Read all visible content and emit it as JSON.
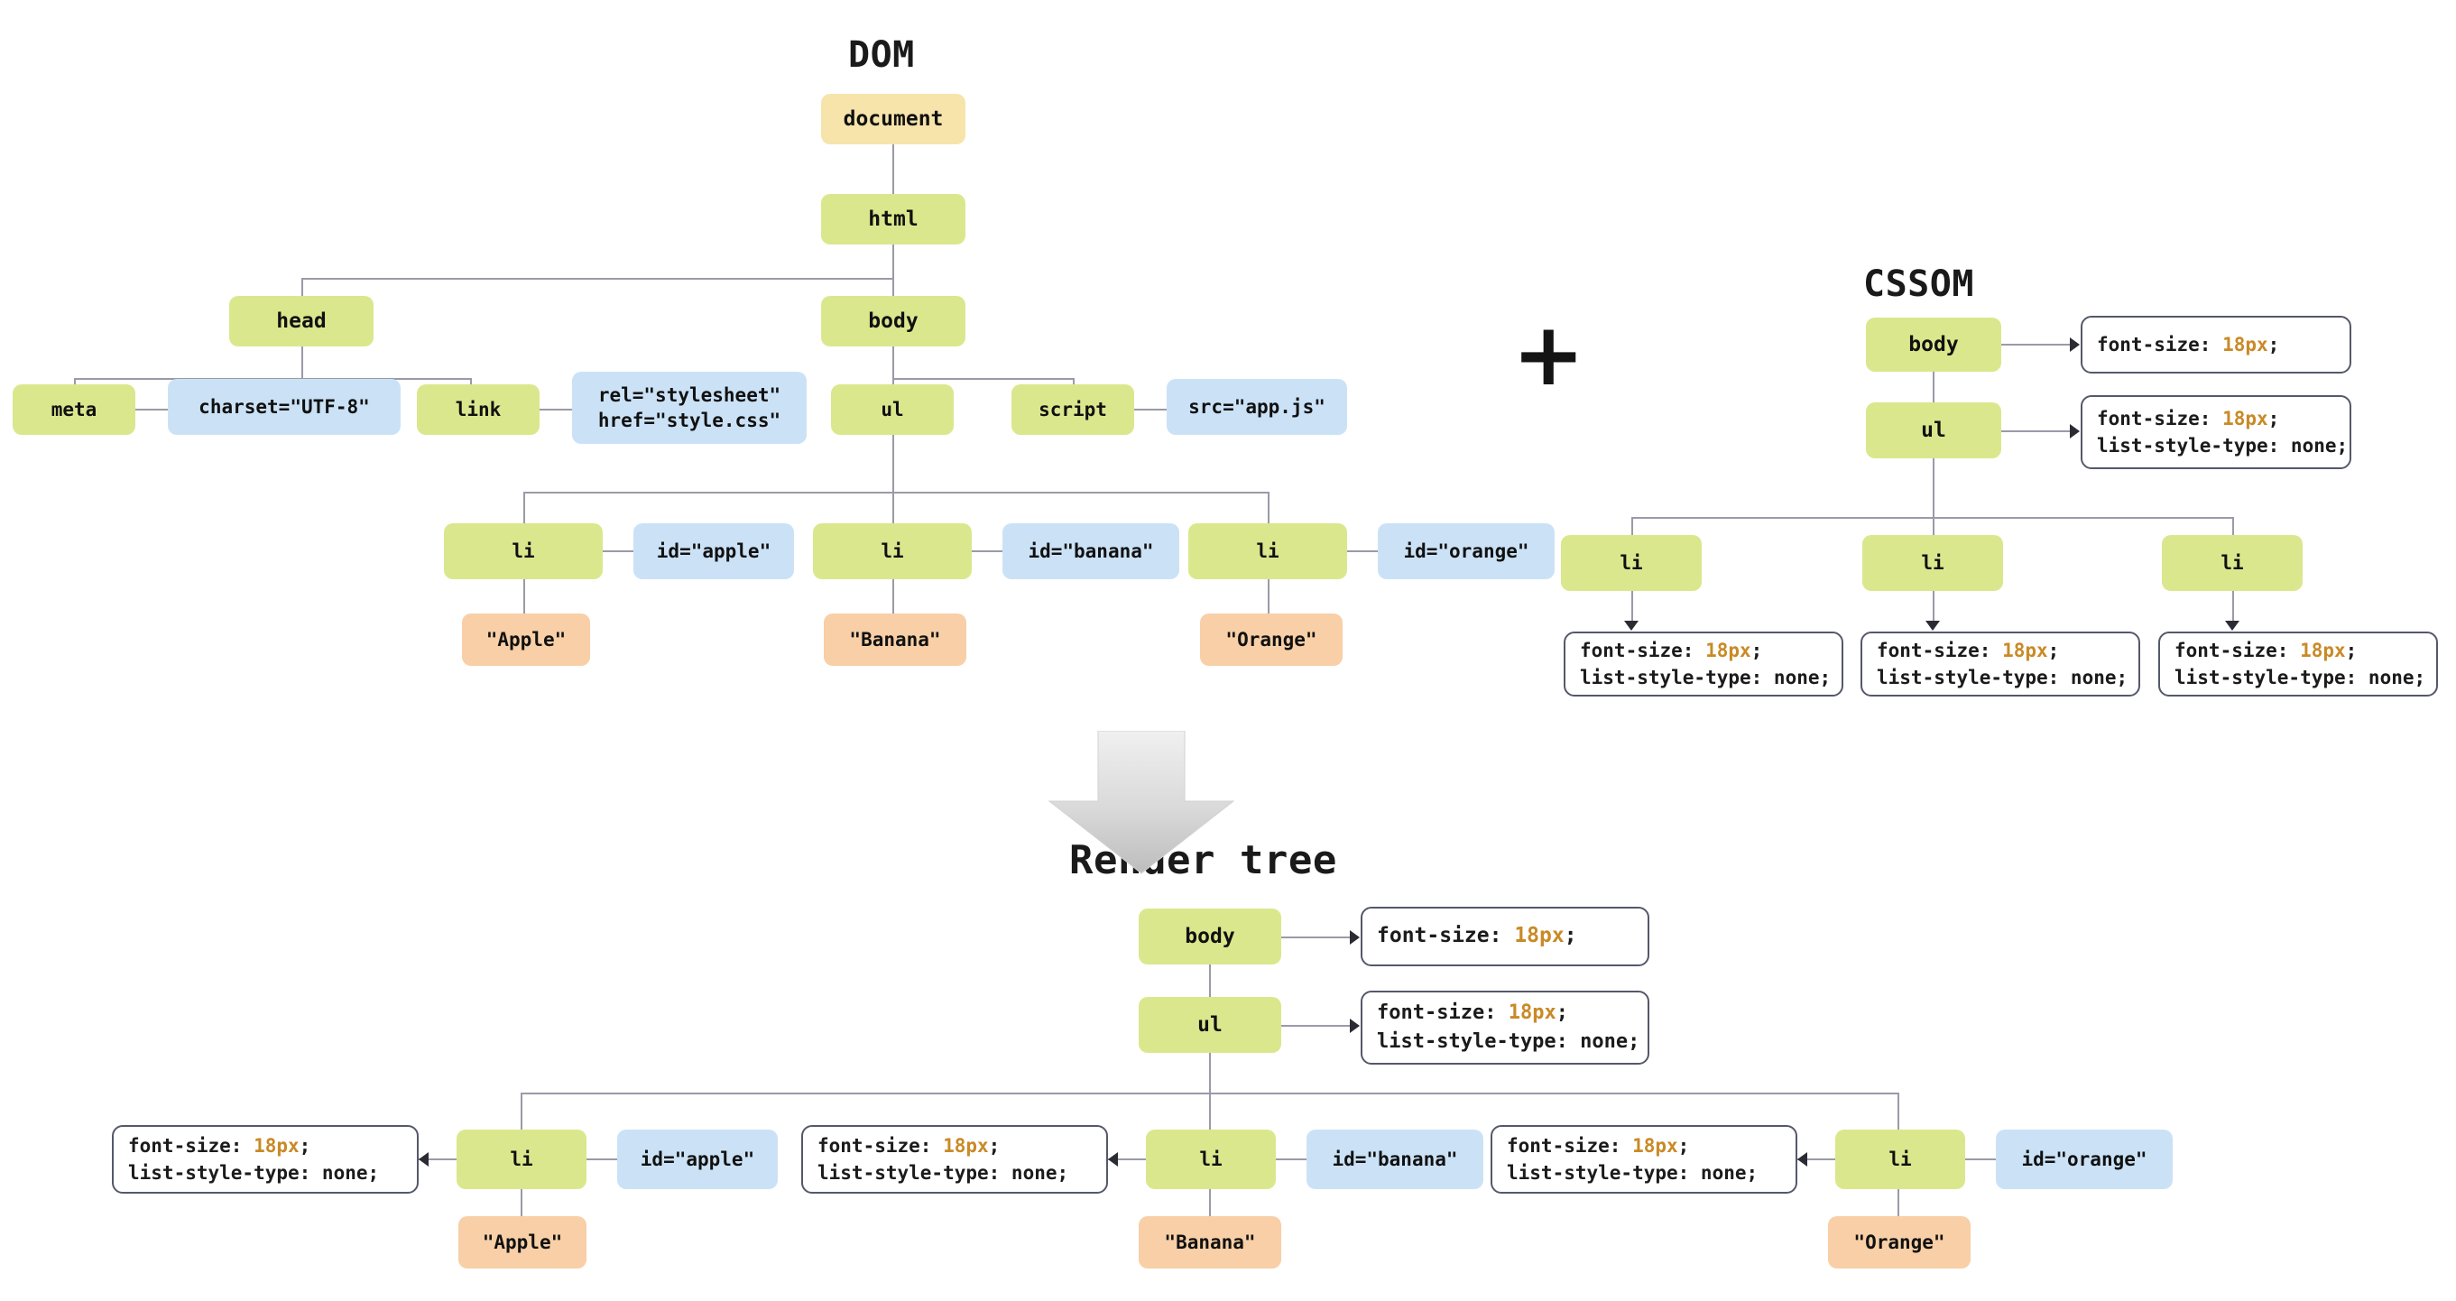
{
  "titles": {
    "dom": "DOM",
    "cssom": "CSSOM",
    "render_tree": "Render tree",
    "plus": "+"
  },
  "dom": {
    "document": "document",
    "html": "html",
    "head": "head",
    "body": "body",
    "meta": "meta",
    "meta_attr": "charset=\"UTF-8\"",
    "link": "link",
    "link_attr": "rel=\"stylesheet\"\nhref=\"style.css\"",
    "ul": "ul",
    "script": "script",
    "script_attr": "src=\"app.js\"",
    "items": [
      {
        "tag": "li",
        "attr": "id=\"apple\"",
        "text": "\"Apple\""
      },
      {
        "tag": "li",
        "attr": "id=\"banana\"",
        "text": "\"Banana\""
      },
      {
        "tag": "li",
        "attr": "id=\"orange\"",
        "text": "\"Orange\""
      }
    ]
  },
  "cssom": {
    "body": "body",
    "ul": "ul",
    "body_rule": {
      "prop1": "font-size: ",
      "val1": "18px",
      "end1": ";"
    },
    "ul_rule": {
      "prop1": "font-size: ",
      "val1": "18px",
      "end1": ";",
      "prop2": "list-style-type: none;"
    },
    "items": [
      {
        "tag": "li",
        "prop1": "font-size: ",
        "val1": "18px",
        "end1": ";",
        "prop2": "list-style-type: none;"
      },
      {
        "tag": "li",
        "prop1": "font-size: ",
        "val1": "18px",
        "end1": ";",
        "prop2": "list-style-type: none;"
      },
      {
        "tag": "li",
        "prop1": "font-size: ",
        "val1": "18px",
        "end1": ";",
        "prop2": "list-style-type: none;"
      }
    ]
  },
  "render": {
    "body": "body",
    "ul": "ul",
    "body_rule": {
      "prop1": "font-size: ",
      "val1": "18px",
      "end1": ";"
    },
    "ul_rule": {
      "prop1": "font-size: ",
      "val1": "18px",
      "end1": ";",
      "prop2": "list-style-type: none;"
    },
    "items": [
      {
        "tag": "li",
        "attr": "id=\"apple\"",
        "text": "\"Apple\"",
        "prop1": "font-size: ",
        "val1": "18px",
        "end1": ";",
        "prop2": "list-style-type: none;"
      },
      {
        "tag": "li",
        "attr": "id=\"banana\"",
        "text": "\"Banana\"",
        "prop1": "font-size: ",
        "val1": "18px",
        "end1": ";",
        "prop2": "list-style-type: none;"
      },
      {
        "tag": "li",
        "attr": "id=\"orange\"",
        "text": "\"Orange\"",
        "prop1": "font-size: ",
        "val1": "18px",
        "end1": ";",
        "prop2": "list-style-type: none;"
      }
    ]
  },
  "colors": {
    "document_node": "#f7e4ab",
    "element_node": "#dbe78d",
    "attribute_node": "#cbe2f6",
    "text_node": "#f8cfa6",
    "css_value": "#c98a26",
    "connector": "#9a9aa8"
  }
}
